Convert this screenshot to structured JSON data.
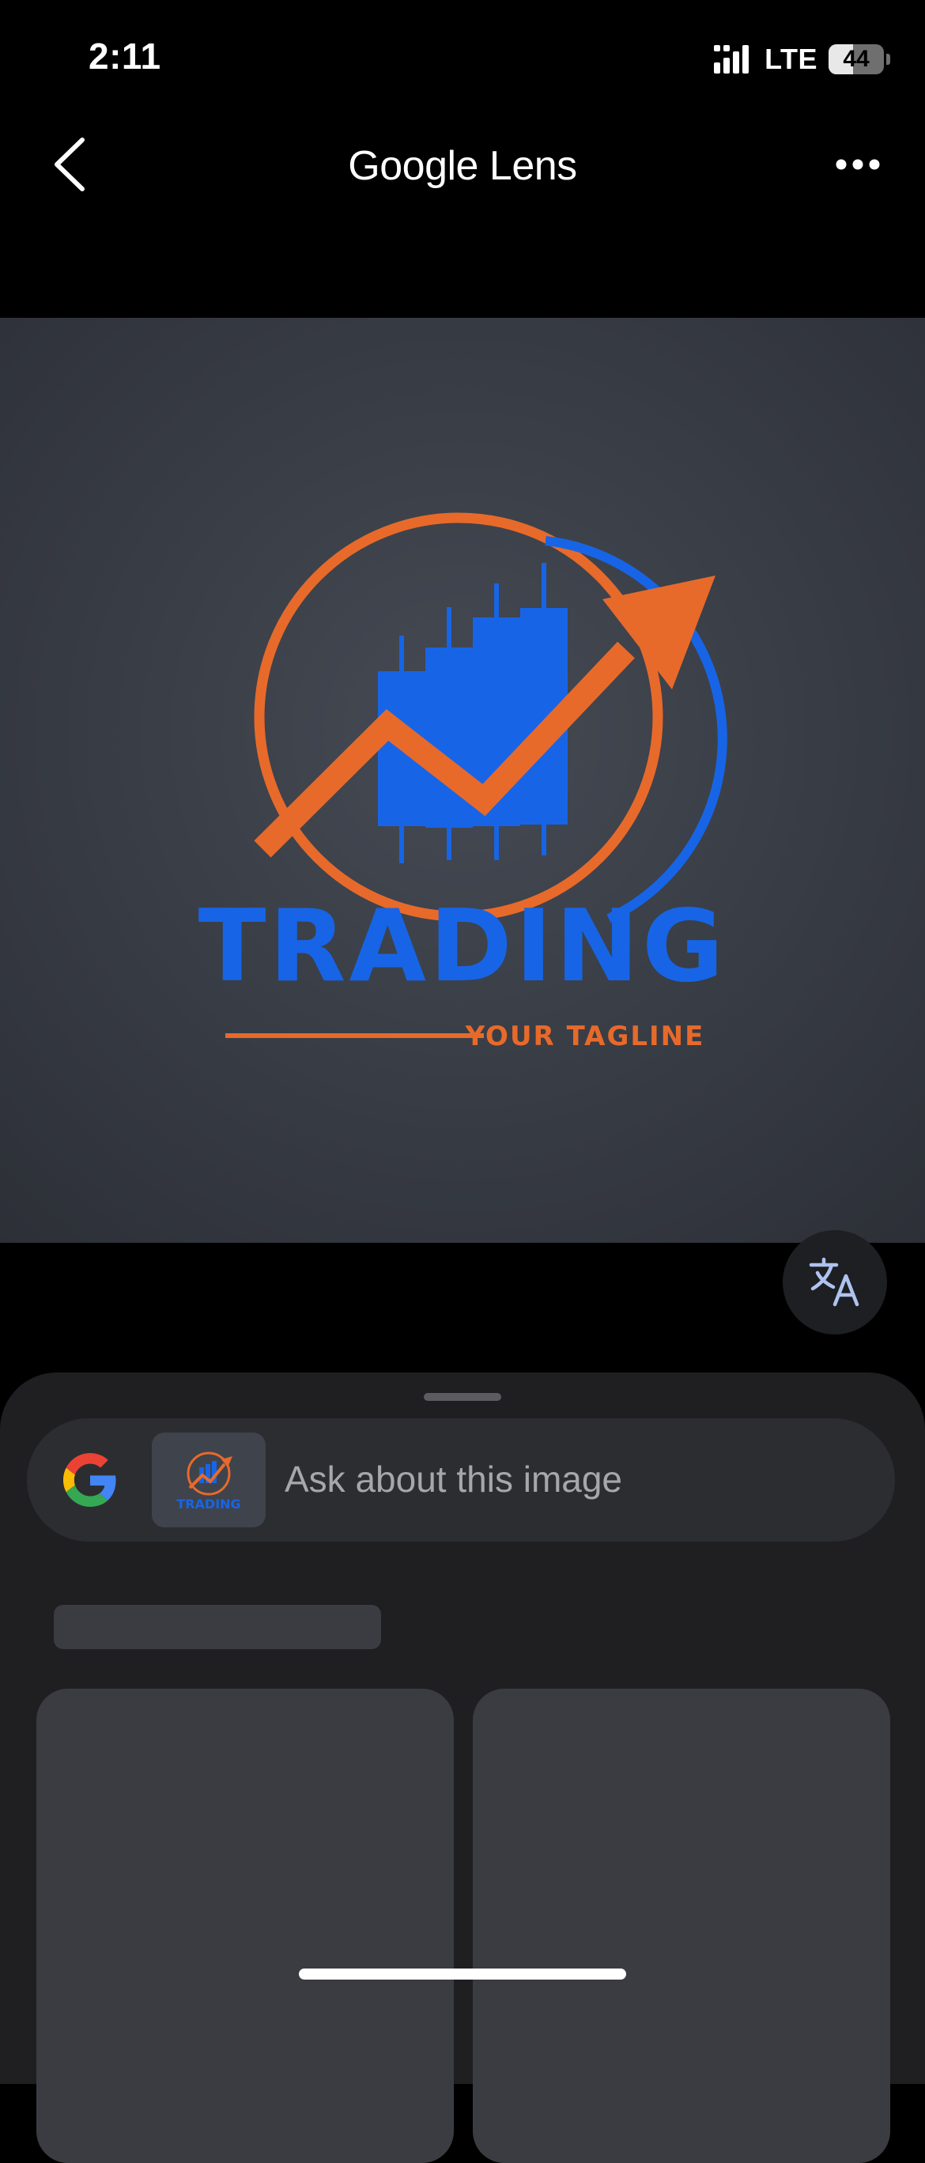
{
  "status_bar": {
    "time": "2:11",
    "network": "LTE",
    "battery": "44",
    "battery_level": 0.44,
    "icons": [
      "signal-icon",
      "battery-icon"
    ]
  },
  "header": {
    "title": "Google Lens",
    "back_icon": "chevron-left-icon",
    "more_icon": "more-horizontal-icon"
  },
  "image": {
    "logo_text": "TRADING",
    "tagline": "YOUR TAGLINE",
    "colors": {
      "blue": "#1765e6",
      "orange": "#e76a2b",
      "background": "#3b3f48"
    }
  },
  "translate_button": {
    "icon": "translate-icon"
  },
  "search": {
    "placeholder": "Ask about this image",
    "thumbnail_text": "TRADING",
    "icon": "google-g-icon"
  },
  "colors": {
    "sheet": "#1f1f22",
    "search_bar": "#2c2d31",
    "skeleton": "#3b3c41",
    "placeholder_text": "#a6a7ab"
  }
}
